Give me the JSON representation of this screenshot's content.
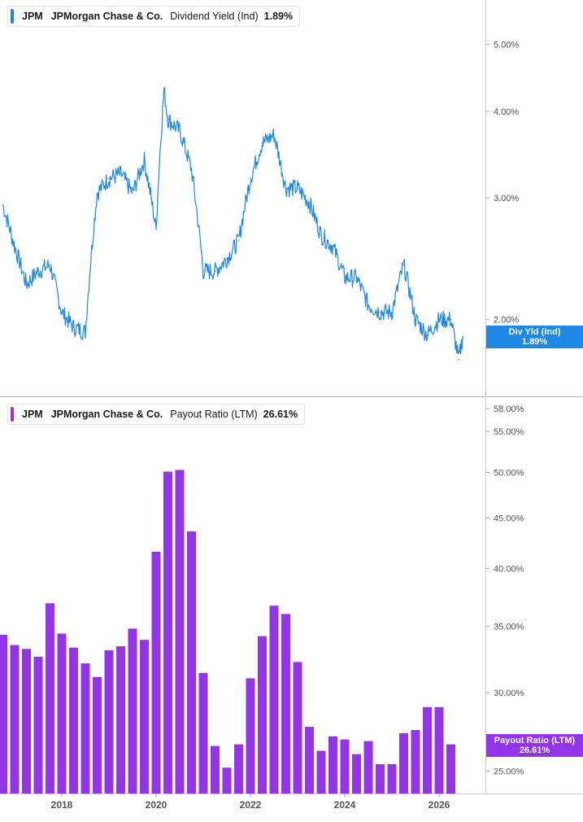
{
  "chart_data": [
    {
      "type": "line",
      "ticker": "JPM",
      "company": "JPMorgan Chase & Co.",
      "metric": "Dividend Yield (Ind)",
      "value_label": "1.89%",
      "badge_label": "Div Yld (Ind)",
      "color": "#1e88e5",
      "scale": "log",
      "ylim": [
        1.68,
        5.8
      ],
      "y_ticks": [
        "5.00%",
        "4.00%",
        "3.00%",
        "2.00%"
      ],
      "x": [
        "2016-10",
        "2017-01",
        "2017-04",
        "2017-07",
        "2017-10",
        "2018-01",
        "2018-04",
        "2018-07",
        "2018-10",
        "2019-01",
        "2019-04",
        "2019-07",
        "2019-10",
        "2020-01",
        "2020-03",
        "2020-04",
        "2020-07",
        "2020-10",
        "2021-01",
        "2021-04",
        "2021-07",
        "2021-10",
        "2022-01",
        "2022-04",
        "2022-07",
        "2022-10",
        "2023-01",
        "2023-04",
        "2023-07",
        "2023-10",
        "2024-01",
        "2024-04",
        "2024-07",
        "2024-10",
        "2025-01",
        "2025-04",
        "2025-07",
        "2025-10",
        "2026-01",
        "2026-04",
        "2026-06",
        "2026-07"
      ],
      "values": [
        2.93,
        2.55,
        2.25,
        2.35,
        2.4,
        2.05,
        1.95,
        1.92,
        3.05,
        3.2,
        3.25,
        3.05,
        3.4,
        2.7,
        4.3,
        3.9,
        3.75,
        3.3,
        2.35,
        2.35,
        2.45,
        2.6,
        3.2,
        3.6,
        3.7,
        3.1,
        3.1,
        2.95,
        2.65,
        2.55,
        2.3,
        2.3,
        2.1,
        2.05,
        2.05,
        2.4,
        2.0,
        1.9,
        2.0,
        2.0,
        1.75,
        1.89
      ]
    },
    {
      "type": "bar",
      "ticker": "JPM",
      "company": "JPMorgan Chase & Co.",
      "metric": "Payout Ratio (LTM)",
      "value_label": "26.61%",
      "badge_label": "Payout Ratio (LTM)",
      "color": "#9334ea",
      "scale": "log",
      "ylim": [
        24.0,
        58.0
      ],
      "y_ticks": [
        "58.00%",
        "55.00%",
        "50.00%",
        "45.00%",
        "40.00%",
        "35.00%",
        "30.00%",
        "25.00%"
      ],
      "x": [
        "2016-07",
        "2016-10",
        "2017-01",
        "2017-04",
        "2017-07",
        "2017-10",
        "2018-01",
        "2018-04",
        "2018-07",
        "2018-10",
        "2019-01",
        "2019-04",
        "2019-07",
        "2019-10",
        "2020-01",
        "2020-04",
        "2020-07",
        "2020-10",
        "2021-01",
        "2021-04",
        "2021-07",
        "2021-10",
        "2022-01",
        "2022-04",
        "2022-07",
        "2022-10",
        "2023-01",
        "2023-04",
        "2023-07",
        "2023-10",
        "2024-01",
        "2024-04",
        "2024-07",
        "2024-10",
        "2025-01",
        "2025-04",
        "2025-07",
        "2025-10",
        "2026-01",
        "2026-04",
        "2026-07"
      ],
      "values": [
        35.9,
        34.3,
        33.5,
        33.2,
        32.6,
        36.9,
        34.4,
        33.3,
        32.1,
        31.1,
        33.1,
        33.4,
        34.8,
        33.9,
        41.6,
        50.1,
        50.3,
        43.6,
        31.4,
        26.5,
        25.2,
        26.6,
        31.0,
        34.2,
        36.7,
        36.0,
        32.2,
        27.7,
        26.2,
        27.1,
        26.9,
        26.0,
        26.8,
        25.4,
        25.4,
        27.3,
        27.5,
        29.0,
        29.0,
        26.6
      ]
    }
  ],
  "x_axis": {
    "labels": [
      "2018",
      "2020",
      "2022",
      "2024",
      "2026"
    ]
  }
}
